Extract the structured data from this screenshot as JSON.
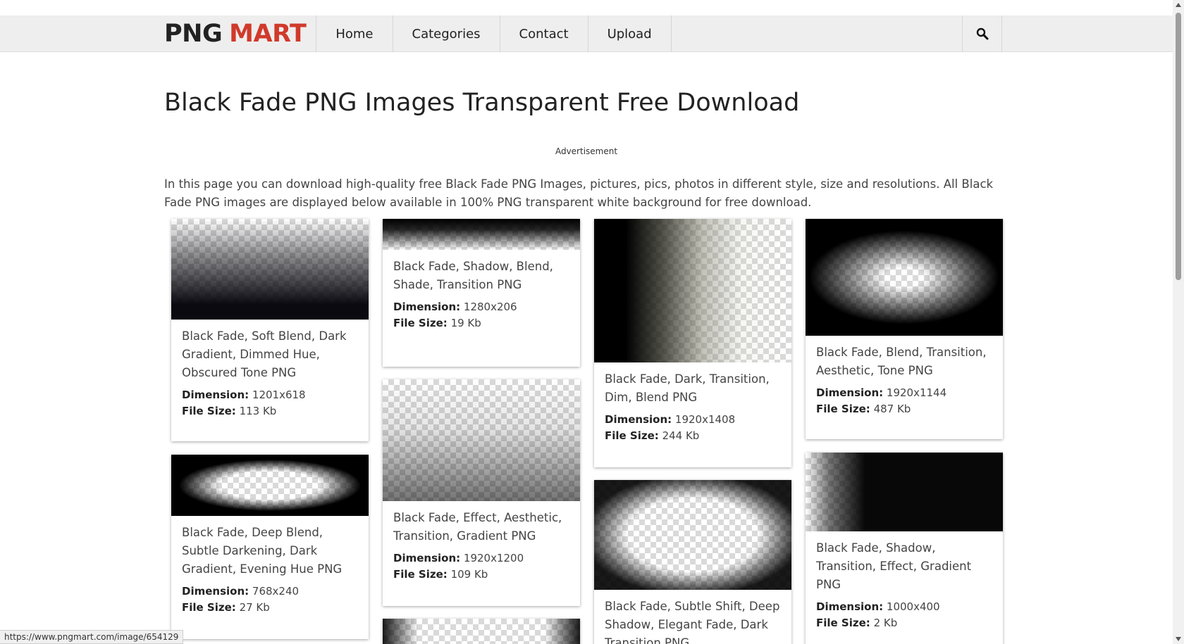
{
  "header": {
    "logo_part1": "PNG",
    "logo_part2": "MART",
    "logo_accent_color": "#d03a2b",
    "nav": [
      {
        "label": "Home"
      },
      {
        "label": "Categories"
      },
      {
        "label": "Contact"
      },
      {
        "label": "Upload"
      }
    ],
    "search_icon": "search-icon"
  },
  "main": {
    "title": "Black Fade PNG Images Transparent Free Download",
    "ad_label": "Advertisement",
    "intro": "In this page you can download high-quality free Black Fade PNG Images, pictures, pics, photos in different style, size and resolutions. All Black Fade PNG images are displayed below available in 100% PNG transparent white background for free download."
  },
  "labels": {
    "dimension": "Dimension:",
    "file_size": "File Size:"
  },
  "cards": [
    {
      "title": "Black Fade, Soft Blend, Dark Gradient, Dimmed Hue, Obscured Tone PNG",
      "dimension": "1201x618",
      "file_size": "113 Kb"
    },
    {
      "title": "Black Fade, Shadow, Blend, Shade, Transition PNG",
      "dimension": "1280x206",
      "file_size": "19 Kb"
    },
    {
      "title": "Black Fade, Dark, Transition, Dim, Blend PNG",
      "dimension": "1920x1408",
      "file_size": "244 Kb"
    },
    {
      "title": "Black Fade, Blend, Transition, Aesthetic, Tone PNG",
      "dimension": "1920x1144",
      "file_size": "487 Kb"
    },
    {
      "title": "Black Fade, Deep Blend, Subtle Darkening, Dark Gradient, Evening Hue PNG",
      "dimension": "768x240",
      "file_size": "27 Kb"
    },
    {
      "title": "Black Fade, Effect, Aesthetic, Transition, Gradient PNG",
      "dimension": "1920x1200",
      "file_size": "109 Kb"
    },
    {
      "title": "Black Fade, Subtle Shift, Deep Shadow, Elegant Fade, Dark Transition PNG",
      "dimension": "",
      "file_size": ""
    },
    {
      "title": "Black Fade, Shadow, Transition, Effect, Gradient PNG",
      "dimension": "1000x400",
      "file_size": "2 Kb"
    },
    {
      "title": "",
      "dimension": "",
      "file_size": ""
    }
  ],
  "status_bar": {
    "url": "https://www.pngmart.com/image/654129"
  }
}
